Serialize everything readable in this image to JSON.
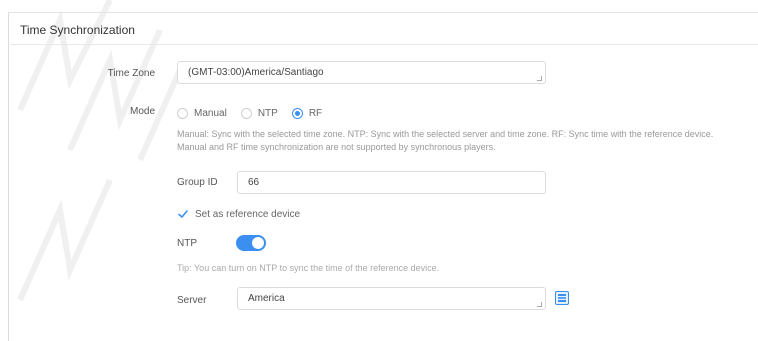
{
  "section": {
    "title": "Time Synchronization"
  },
  "time_zone": {
    "label": "Time Zone",
    "value": "(GMT-03:00)America/Santiago"
  },
  "mode": {
    "label": "Mode",
    "options": [
      {
        "label": "Manual",
        "checked": false
      },
      {
        "label": "NTP",
        "checked": false
      },
      {
        "label": "RF",
        "checked": true
      }
    ],
    "help_line1": "Manual: Sync with the selected time zone. NTP: Sync with the selected server and time zone. RF: Sync time with the reference device.",
    "help_line2": "Manual and RF time synchronization are not supported by synchronous players."
  },
  "group_id": {
    "label": "Group ID",
    "value": "66"
  },
  "reference_device": {
    "label": "Set as reference device",
    "checked": true
  },
  "ntp": {
    "label": "NTP",
    "enabled": true,
    "tip": "Tip: You can turn on NTP to sync the time of the reference device."
  },
  "server": {
    "label": "Server",
    "value": "America"
  },
  "colors": {
    "accent": "#3b8ff0"
  },
  "icons": {
    "checkbox": "check-icon",
    "server_picker": "server-list-icon"
  }
}
